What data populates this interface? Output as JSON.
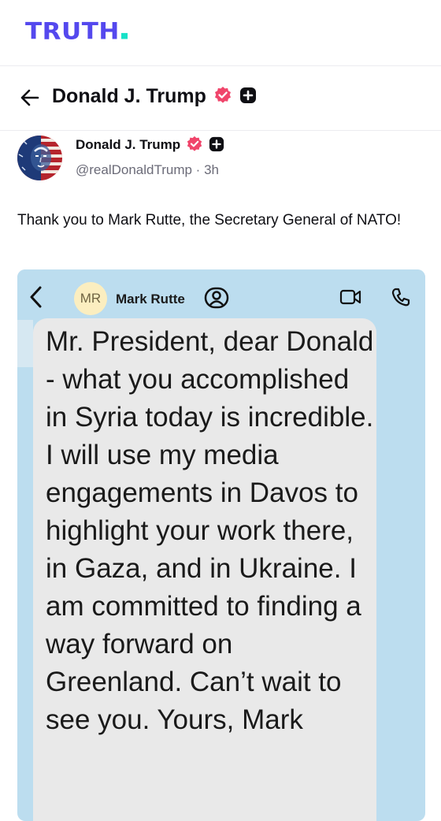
{
  "app": {
    "logo_text": "TRUTH",
    "logo_colors": {
      "text": "#5448ee",
      "dot": "#17e2c8"
    }
  },
  "profile_header": {
    "name": "Donald J. Trump",
    "icons": [
      "back-arrow-icon",
      "verified-badge-icon",
      "plus-badge-icon"
    ]
  },
  "post": {
    "author_name": "Donald J. Trump",
    "author_handle": "@realDonaldTrump · 3h",
    "text": "Thank you to Mark Rutte, the Secretary General of NATO!",
    "media": {
      "chat": {
        "contact_initials": "MR",
        "contact_name": "Mark Rutte",
        "message": "Mr. President, dear Donald - what you accomplished in Syria today is incredible. I will use my media engagements in Davos to highlight your work there, in Gaza, and in Ukraine. I am committed to finding a way forward on Greenland. Can’t wait to see you. Yours, Mark",
        "icons": [
          "chevron-left-icon",
          "contact-icon",
          "video-call-icon",
          "phone-call-icon"
        ],
        "colors": {
          "background": "#bcddef",
          "bubble": "#e9e9e9"
        }
      }
    }
  },
  "colors": {
    "verified_badge": "#f0456b",
    "accent": "#5448ee"
  }
}
